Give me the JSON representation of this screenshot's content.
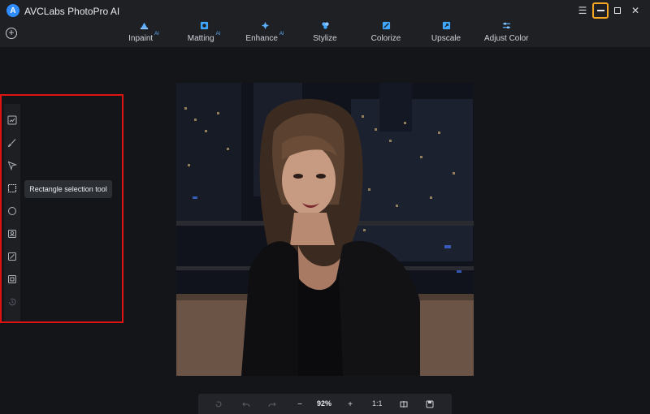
{
  "app": {
    "title": "AVCLabs PhotoPro AI",
    "logo_letter": "A"
  },
  "window_controls": {
    "menu_icon": "hamburger-icon",
    "minimize_icon": "minimize-icon",
    "maximize_icon": "maximize-icon",
    "close_icon": "close-icon",
    "close_glyph": "✕",
    "menu_glyph": "☰"
  },
  "add_button": {
    "glyph": "+"
  },
  "tabs": [
    {
      "label": "Inpaint",
      "badge": "AI",
      "icon": "inpaint-icon"
    },
    {
      "label": "Matting",
      "badge": "AI",
      "icon": "matting-icon"
    },
    {
      "label": "Enhance",
      "badge": "AI",
      "icon": "enhance-icon"
    },
    {
      "label": "Stylize",
      "badge": "",
      "icon": "stylize-icon"
    },
    {
      "label": "Colorize",
      "badge": "",
      "icon": "colorize-icon"
    },
    {
      "label": "Upscale",
      "badge": "",
      "icon": "upscale-icon"
    },
    {
      "label": "Adjust Color",
      "badge": "",
      "icon": "adjust-color-icon"
    }
  ],
  "tools": [
    {
      "name": "auto-select-tool",
      "icon": "auto-select-icon"
    },
    {
      "name": "brush-tool",
      "icon": "brush-icon"
    },
    {
      "name": "lasso-tool",
      "icon": "lasso-icon"
    },
    {
      "name": "rectangle-selection-tool",
      "icon": "rectangle-selection-icon"
    },
    {
      "name": "ellipse-selection-tool",
      "icon": "ellipse-selection-icon"
    },
    {
      "name": "portrait-select-tool",
      "icon": "portrait-icon"
    },
    {
      "name": "invert-selection-tool",
      "icon": "invert-icon"
    },
    {
      "name": "object-select-tool",
      "icon": "object-select-icon"
    },
    {
      "name": "history-tool",
      "icon": "history-icon"
    }
  ],
  "tooltip": {
    "text": "Rectangle selection tool"
  },
  "bottom_bar": {
    "zoom": "92%",
    "ratio": "1:1",
    "minus_glyph": "−",
    "plus_glyph": "+"
  },
  "colors": {
    "accent": "#2f8cff",
    "highlight_outline": "#e01313",
    "minimize_focus": "#f5a623",
    "background": "#141518",
    "titlebar": "#1e2024"
  }
}
